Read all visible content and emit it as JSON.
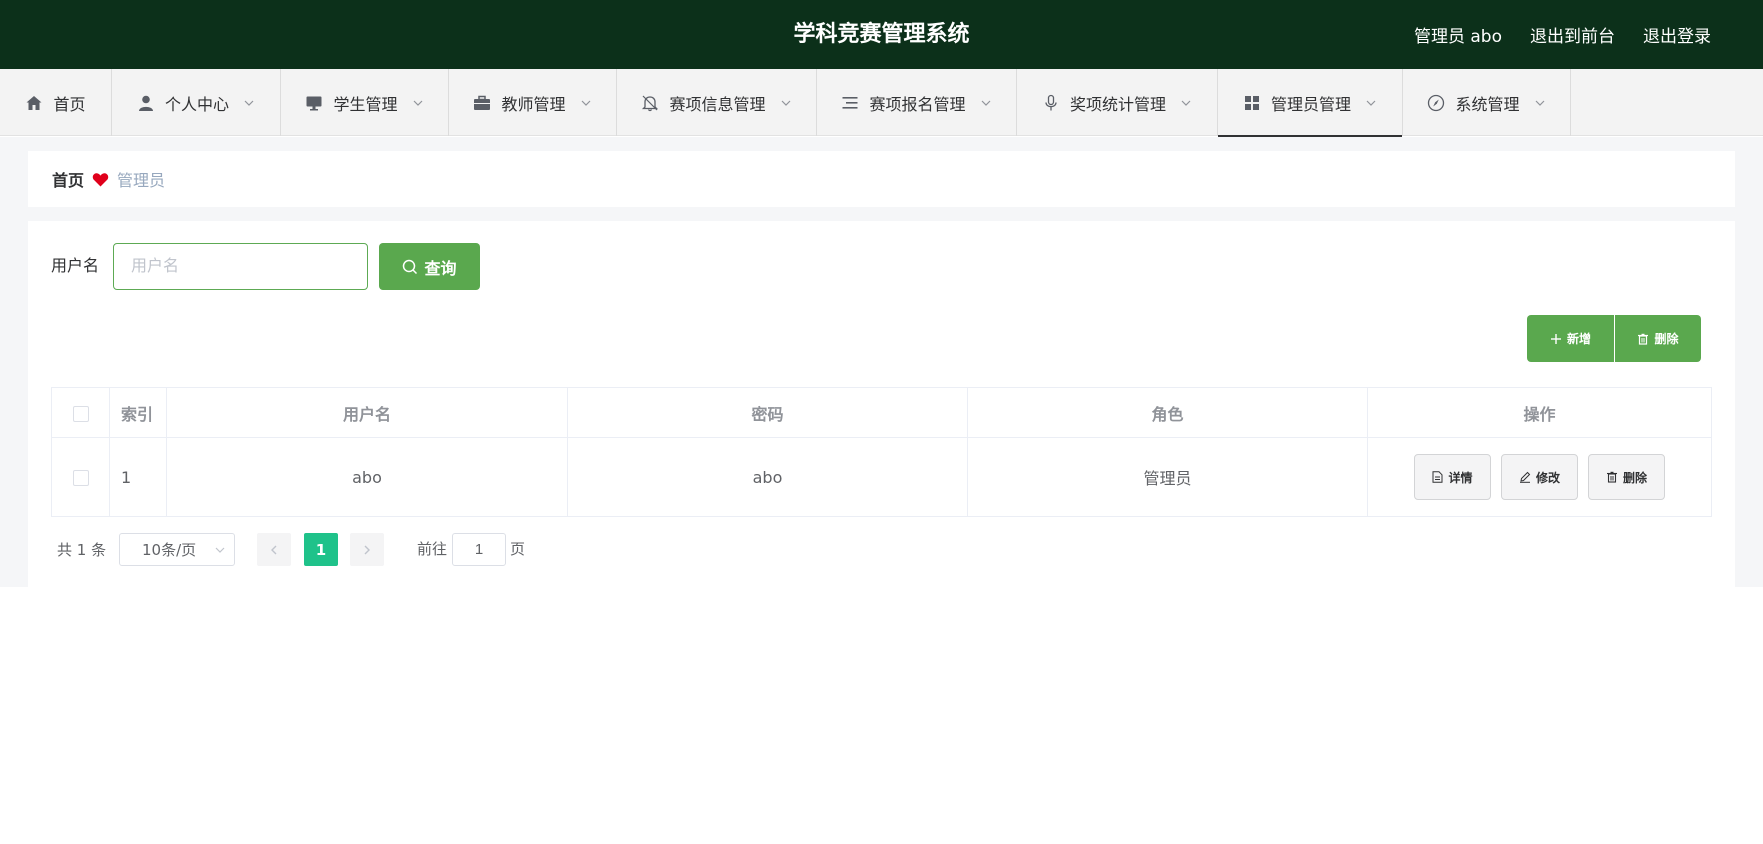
{
  "header": {
    "title": "学科竞赛管理系统",
    "user_label": "管理员 abo",
    "to_front_label": "退出到前台",
    "logout_label": "退出登录"
  },
  "nav": {
    "items": [
      {
        "label": "首页",
        "icon": "home-icon"
      },
      {
        "label": "个人中心",
        "icon": "user-icon"
      },
      {
        "label": "学生管理",
        "icon": "monitor-icon"
      },
      {
        "label": "教师管理",
        "icon": "briefcase-icon"
      },
      {
        "label": "赛项信息管理",
        "icon": "bell-icon"
      },
      {
        "label": "赛项报名管理",
        "icon": "list-icon"
      },
      {
        "label": "奖项统计管理",
        "icon": "microphone-icon"
      },
      {
        "label": "管理员管理",
        "icon": "grid-icon",
        "active": true
      },
      {
        "label": "系统管理",
        "icon": "compass-icon"
      }
    ]
  },
  "breadcrumb": {
    "home": "首页",
    "current": "管理员"
  },
  "search": {
    "label": "用户名",
    "placeholder": "用户名",
    "value": "",
    "button_label": "查询"
  },
  "actions": {
    "add_label": "新增",
    "delete_label": "删除"
  },
  "table": {
    "columns": [
      "索引",
      "用户名",
      "密码",
      "角色",
      "操作"
    ],
    "rows": [
      {
        "index": "1",
        "username": "abo",
        "password": "abo",
        "role": "管理员"
      }
    ],
    "row_actions": {
      "detail": "详情",
      "edit": "修改",
      "delete": "删除"
    }
  },
  "pagination": {
    "total_text": "共 1 条",
    "page_size": "10条/页",
    "current_page": "1",
    "goto_label": "前往",
    "goto_value": "1",
    "goto_unit": "页"
  },
  "colors": {
    "header_bg": "#0c301a",
    "primary_green": "#5aa84e",
    "page_active": "#1fc28a",
    "heart": "#e0001b"
  }
}
